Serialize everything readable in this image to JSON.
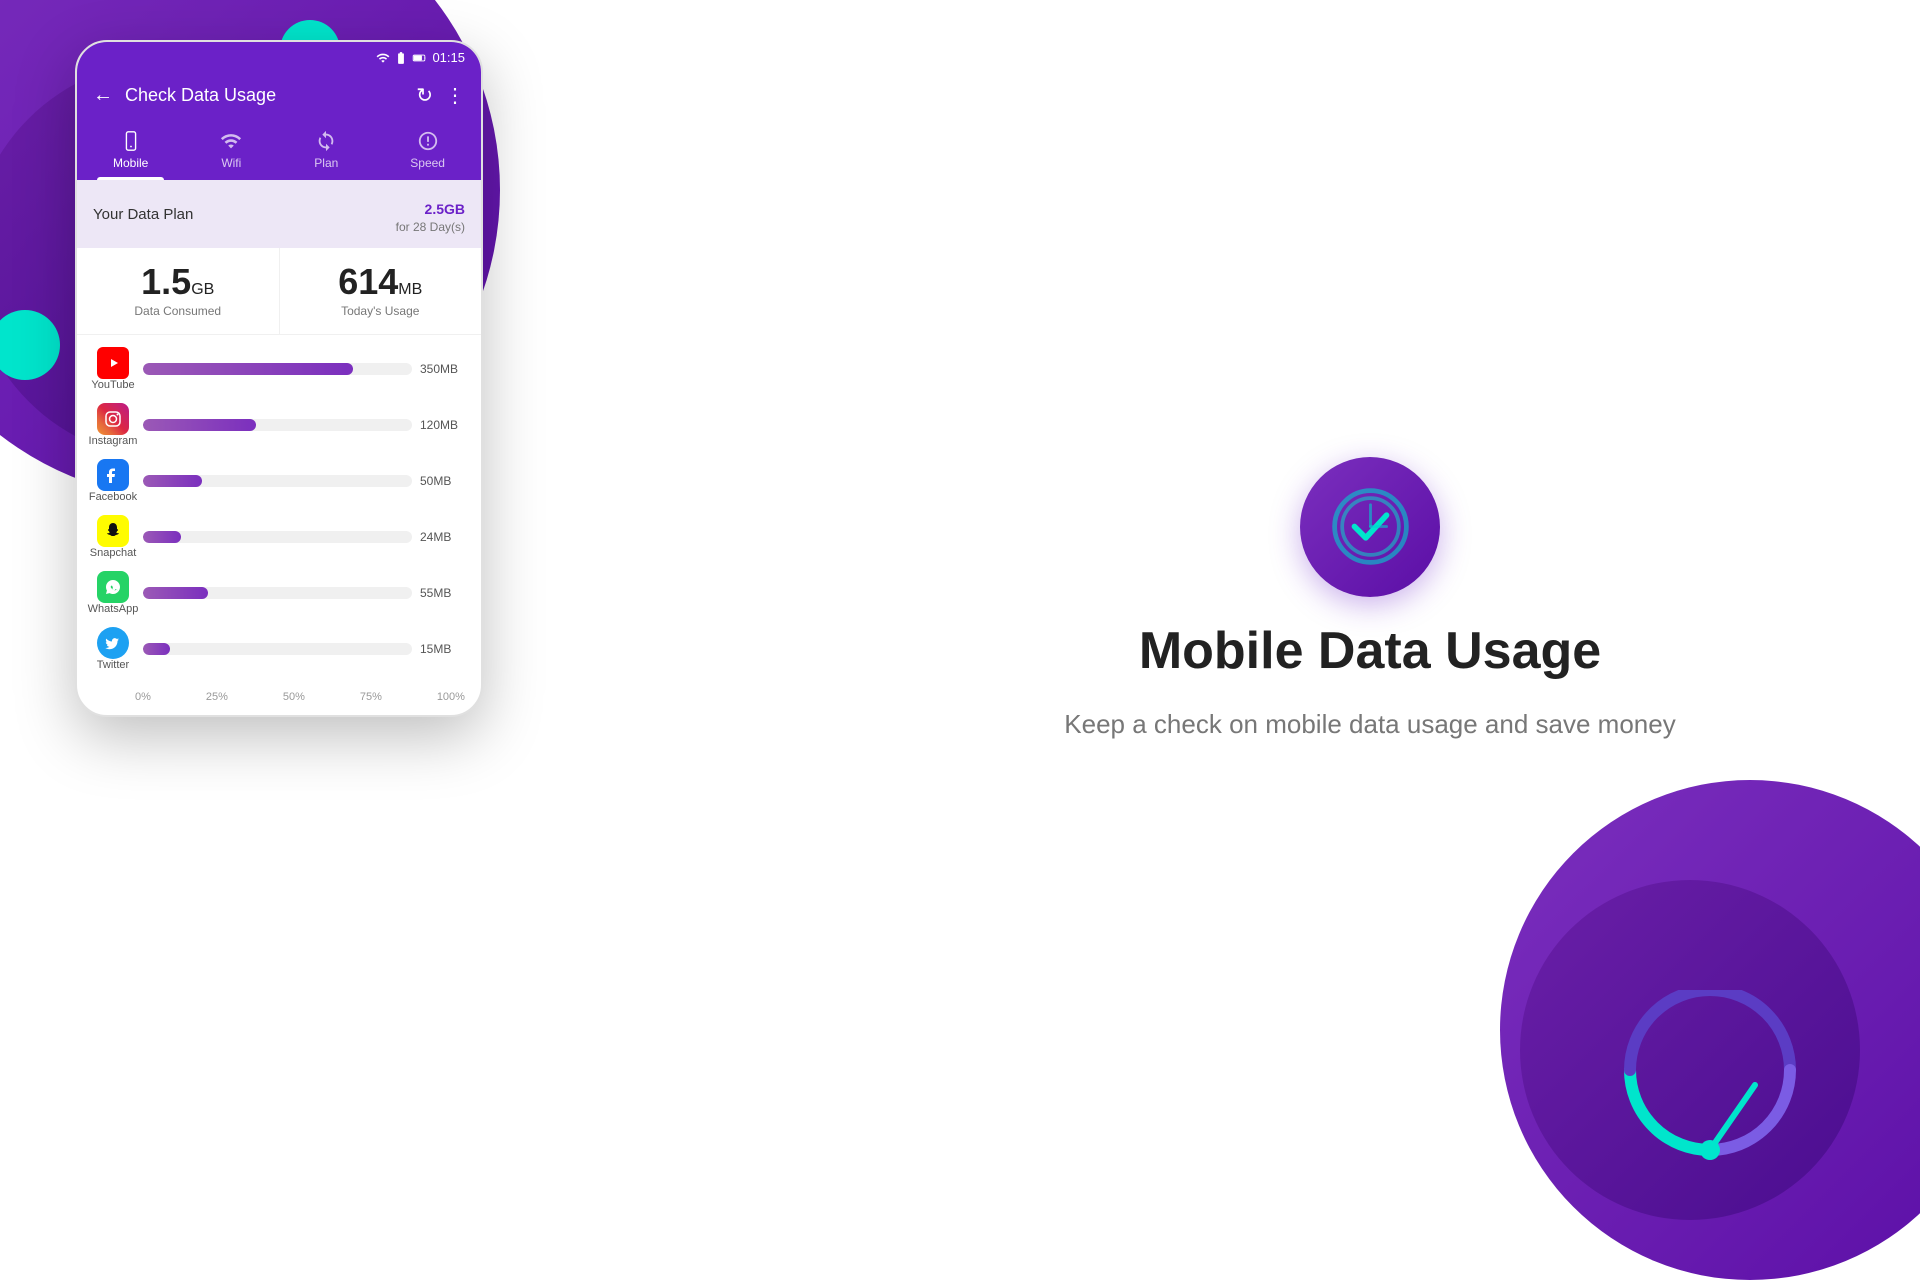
{
  "background": {
    "primaryColor": "#6B21C8",
    "accentColor": "#00E5CC"
  },
  "phone": {
    "statusBar": {
      "time": "01:15"
    },
    "header": {
      "title": "Check Data Usage",
      "backIcon": "←",
      "refreshIcon": "↻",
      "menuIcon": "⋮"
    },
    "tabs": [
      {
        "label": "Mobile",
        "icon": "📱",
        "active": true
      },
      {
        "label": "Wifi",
        "icon": "📶",
        "active": false
      },
      {
        "label": "Plan",
        "icon": "🔄",
        "active": false
      },
      {
        "label": "Speed",
        "icon": "⚡",
        "active": false
      }
    ],
    "dataPlan": {
      "label": "Your Data Plan",
      "amount": "2.5",
      "unit": "GB",
      "duration": "for 28 Day(s)"
    },
    "stats": {
      "consumed": {
        "value": "1.5",
        "unit": "GB",
        "label": "Data Consumed"
      },
      "todayUsage": {
        "value": "614",
        "unit": "MB",
        "label": "Today's Usage"
      }
    },
    "apps": [
      {
        "name": "YouTube",
        "usage": "350MB",
        "percent": 78,
        "iconType": "youtube"
      },
      {
        "name": "Instagram",
        "usage": "120MB",
        "percent": 42,
        "iconType": "instagram"
      },
      {
        "name": "Facebook",
        "usage": "50MB",
        "percent": 22,
        "iconType": "facebook"
      },
      {
        "name": "Snapchat",
        "usage": "24MB",
        "percent": 14,
        "iconType": "snapchat"
      },
      {
        "name": "WhatsApp",
        "usage": "55MB",
        "percent": 24,
        "iconType": "whatsapp"
      },
      {
        "name": "Twitter",
        "usage": "15MB",
        "percent": 10,
        "iconType": "twitter"
      }
    ],
    "xAxis": [
      "0%",
      "25%",
      "50%",
      "75%",
      "100%"
    ]
  },
  "rightPanel": {
    "title": "Mobile Data Usage",
    "subtitle": "Keep a check on mobile data usage and save money"
  }
}
